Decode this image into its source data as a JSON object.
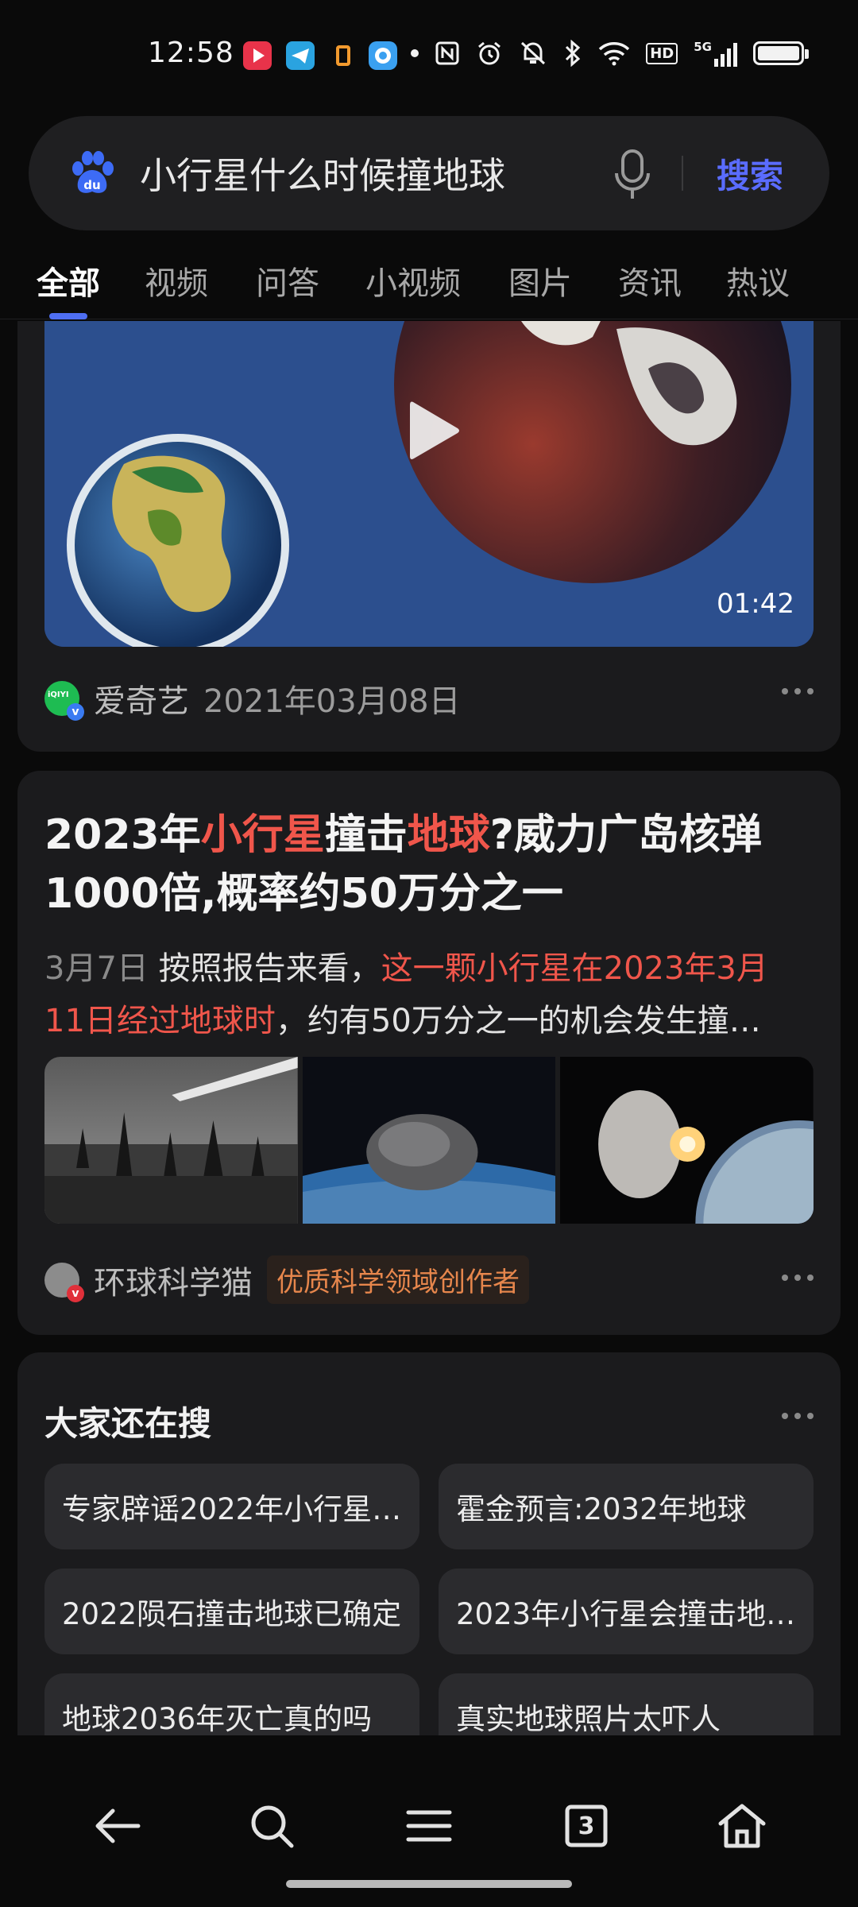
{
  "status_bar": {
    "time": "12:58",
    "icons": [
      "nfc-icon",
      "alarm-icon",
      "mute-icon",
      "bluetooth-icon",
      "wifi-icon",
      "hd-icon",
      "signal-5g-icon",
      "battery-icon"
    ],
    "hd_label": "HD",
    "network_label": "5G"
  },
  "search": {
    "query": "小行星什么时候撞地球",
    "button_label": "搜索"
  },
  "tabs": [
    {
      "label": "全部",
      "active": true
    },
    {
      "label": "视频",
      "active": false
    },
    {
      "label": "问答",
      "active": false
    },
    {
      "label": "小视频",
      "active": false
    },
    {
      "label": "图片",
      "active": false
    },
    {
      "label": "资讯",
      "active": false
    },
    {
      "label": "热议",
      "active": false
    }
  ],
  "video_card": {
    "duration": "01:42",
    "source": "爱奇艺",
    "date": "2021年03月08日",
    "source_icon_text": "iQIYI"
  },
  "article_card": {
    "title_parts": [
      {
        "text": "2023年",
        "hl": false
      },
      {
        "text": "小行星",
        "hl": true
      },
      {
        "text": "撞击",
        "hl": false
      },
      {
        "text": "地球",
        "hl": true
      },
      {
        "text": "?威力广岛核弹1000倍,概率约50万分之一",
        "hl": false
      }
    ],
    "snippet_date": "3月7日",
    "snippet_parts": [
      {
        "text": "按照报告来看，",
        "hl": false
      },
      {
        "text": "这一颗小行星在2023年3月11日经过地球时",
        "hl": true
      },
      {
        "text": "，约有50万分之一的机会发生撞…",
        "hl": false
      }
    ],
    "author": "环球科学猫",
    "author_badge": "优质科学领域创作者"
  },
  "related": {
    "title": "大家还在搜",
    "items": [
      "专家辟谣2022年小行星…",
      "霍金预言:2032年地球",
      "2022陨石撞击地球已确定",
      "2023年小行星会撞击地…",
      "地球2036年灭亡真的吗",
      "真实地球照片太吓人"
    ]
  },
  "bottom_nav": {
    "tab_count": "3",
    "items": [
      "back-icon",
      "search-icon",
      "menu-icon",
      "tabs-icon",
      "home-icon"
    ]
  },
  "colors": {
    "accent": "#4e6ef2",
    "search_button": "#5a6cff",
    "highlight": "#f0564b",
    "badge": "#e6864c",
    "card_bg": "#1b1b1d"
  }
}
